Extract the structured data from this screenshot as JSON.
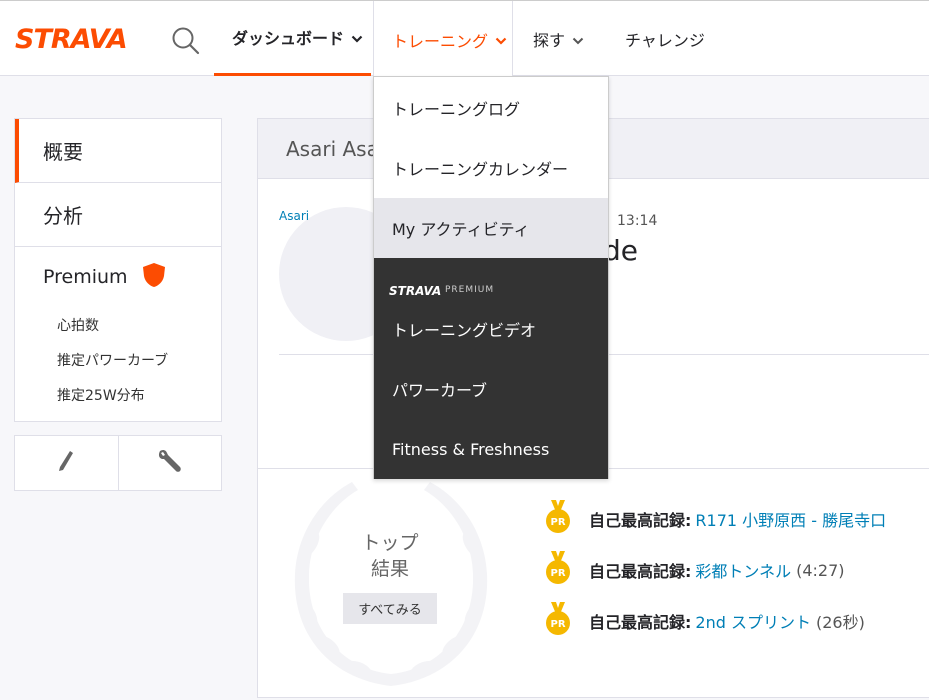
{
  "colors": {
    "brand": "#fc4c02",
    "link": "#007fb6",
    "premium_bg": "#333333",
    "medal": "#f5b800"
  },
  "header": {
    "logo_text": "STRAVA",
    "nav": {
      "dashboard": "ダッシュボード",
      "training": "トレーニング",
      "explore": "探す",
      "challenges": "チャレンジ"
    }
  },
  "sidebar": {
    "items": [
      "概要",
      "分析"
    ],
    "premium_label": "Premium",
    "sub_items": [
      "心拍数",
      "推定パワーカーブ",
      "推定25W分布"
    ]
  },
  "tools": {
    "edit_icon": "pencil-icon",
    "settings_icon": "wrench-icon"
  },
  "main": {
    "header_name": "Asari Asa",
    "avatar_link": "Asari",
    "date_fragment": "、13:14",
    "title_fragment": "de",
    "top_results": {
      "line1": "トップ",
      "line2": "結果",
      "see_all": "すべてみる"
    },
    "prs": [
      {
        "label": "自己最高記録:",
        "link": "R171 小野原西 - 勝尾寺口",
        "time": ""
      },
      {
        "label": "自己最高記録:",
        "link": "彩都トンネル",
        "time": "(4:27)"
      },
      {
        "label": "自己最高記録:",
        "link": "2nd スプリント",
        "time": "(26秒)"
      }
    ],
    "medal_text": "PR"
  },
  "dropdown": {
    "items": [
      "トレーニングログ",
      "トレーニングカレンダー",
      "My アクティビティ"
    ],
    "premium_logo": "STRAVA",
    "premium_sub": "PREMIUM",
    "premium_items": [
      "トレーニングビデオ",
      "パワーカーブ",
      "Fitness & Freshness"
    ]
  }
}
